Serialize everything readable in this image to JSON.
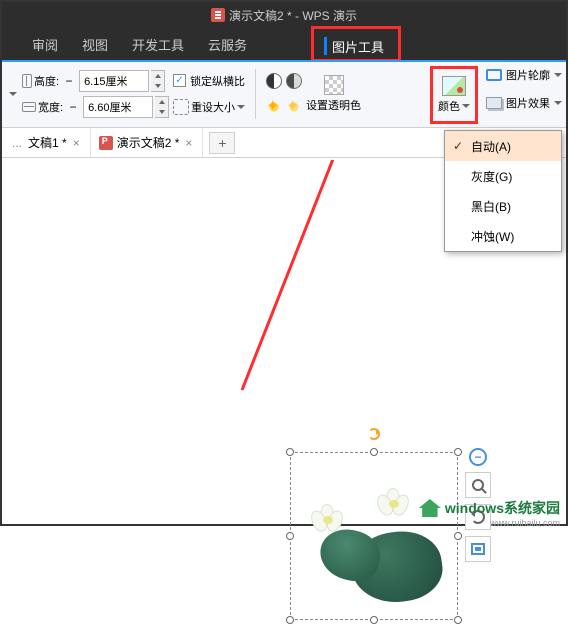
{
  "titlebar": {
    "doc_title": "演示文稿2 * - WPS 演示"
  },
  "menu": {
    "review": "审阅",
    "view": "视图",
    "devtools": "开发工具",
    "cloud": "云服务",
    "pic_tools": "图片工具"
  },
  "ribbon": {
    "height_label": "高度:",
    "width_label": "宽度:",
    "height_value": "6.15厘米",
    "width_value": "6.60厘米",
    "lock_ratio": "锁定纵横比",
    "reset_size": "重设大小",
    "set_transparent": "设置透明色",
    "color_label": "颜色",
    "pic_outline": "图片轮廓",
    "pic_effects": "图片效果"
  },
  "color_menu": {
    "auto": "自动(A)",
    "gray": "灰度(G)",
    "bw": "黑白(B)",
    "washout": "冲蚀(W)"
  },
  "tabs": {
    "tab1": "文稿1 *",
    "tab2": "演示文稿2 *"
  },
  "watermark": {
    "main": "windows系统家园",
    "sub": "www.ruihailu.com"
  }
}
